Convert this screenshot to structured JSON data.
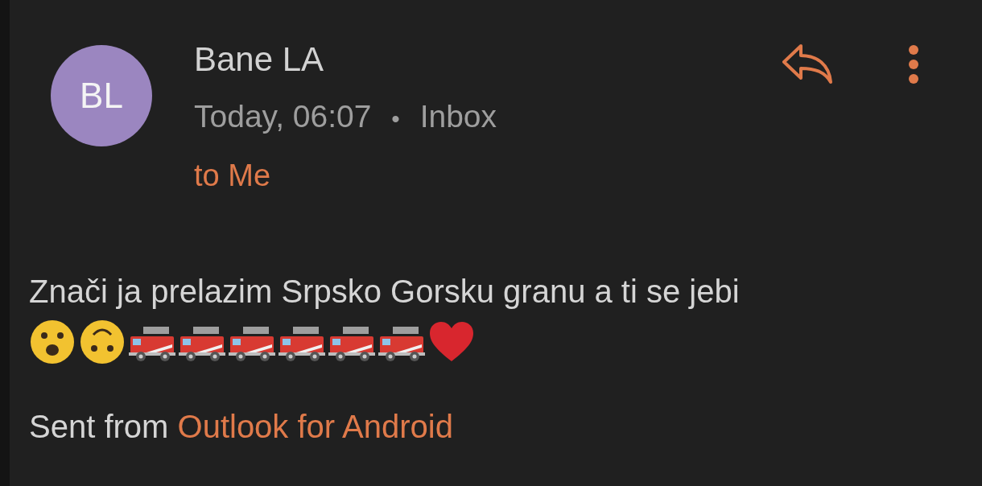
{
  "message": {
    "sender": {
      "initials": "BL",
      "name": "Bane LA"
    },
    "date": "Today, 06:07",
    "separator": "•",
    "folder": "Inbox",
    "recipients": "to Me"
  },
  "body": {
    "text": "Znači ja prelazim Srpsko Gorsku granu a ti se jebi",
    "emojis": [
      {
        "kind": "astonished"
      },
      {
        "kind": "upside-down"
      },
      {
        "kind": "fire-engine"
      },
      {
        "kind": "fire-engine"
      },
      {
        "kind": "fire-engine"
      },
      {
        "kind": "fire-engine"
      },
      {
        "kind": "fire-engine"
      },
      {
        "kind": "fire-engine"
      },
      {
        "kind": "heart"
      }
    ],
    "signature": {
      "prefix": "Sent from",
      "link": "Outlook for Android"
    }
  }
}
